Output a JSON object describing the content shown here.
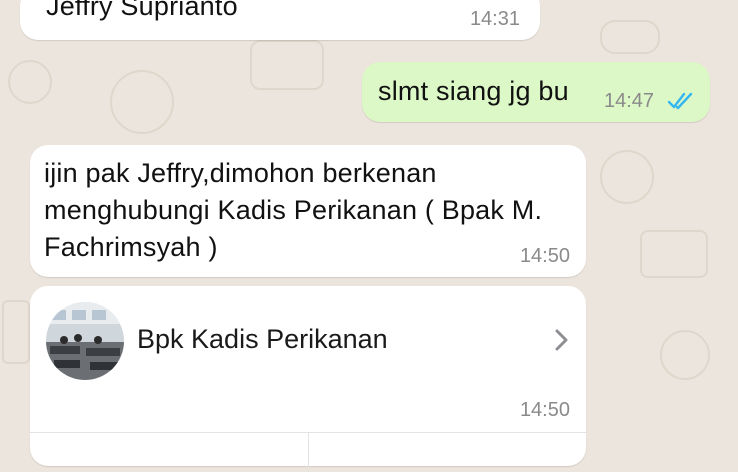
{
  "messages": [
    {
      "sender_name": "Jeffry Suprianto",
      "time": "14:31"
    },
    {
      "text": "slmt siang jg bu",
      "time": "14:47",
      "status_icon": "double-check-read-icon"
    },
    {
      "text": "ijin pak Jeffry,dimohon berkenan menghubungi Kadis Perikanan ( Bpak M. Fachrimsyah )",
      "time": "14:50"
    }
  ],
  "contact_card": {
    "name": "Bpk Kadis Perikanan",
    "time": "14:50",
    "avatar_icon": "contact-photo",
    "open_icon": "chevron-right-icon"
  },
  "colors": {
    "background": "#ece5dd",
    "incoming_bubble": "#ffffff",
    "outgoing_bubble": "#dcf8c6",
    "read_ticks": "#34b7f1"
  }
}
